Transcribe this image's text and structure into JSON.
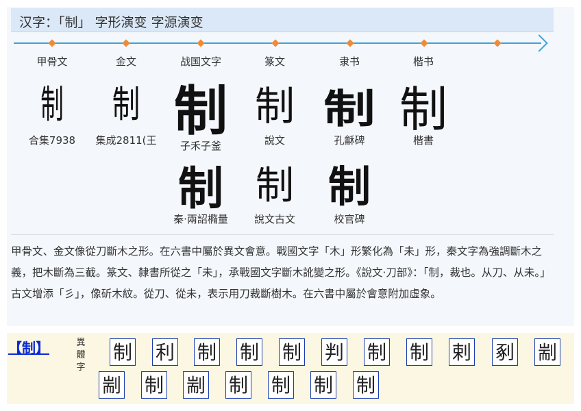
{
  "header": {
    "title": "汉字：「制」 字形演变 字源演变"
  },
  "timeline": {
    "columns": [
      {
        "label": "甲骨文"
      },
      {
        "label": "金文"
      },
      {
        "label": "战国文字"
      },
      {
        "label": "篆文"
      },
      {
        "label": "隶书"
      },
      {
        "label": "楷书"
      }
    ]
  },
  "forms_row1": [
    {
      "glyph": "制",
      "source": "合集7938"
    },
    {
      "glyph": "制",
      "source": "集成2811(王"
    },
    {
      "glyph": "制",
      "source": "子禾子釜"
    },
    {
      "glyph": "制",
      "source": "說文"
    },
    {
      "glyph": "制",
      "source": "孔龢碑"
    },
    {
      "glyph": "制",
      "source": "楷書"
    }
  ],
  "forms_row2": [
    {
      "glyph": "制",
      "source": "秦·兩詔橢量"
    },
    {
      "glyph": "制",
      "source": "說文古文"
    },
    {
      "glyph": "制",
      "source": "校官碑"
    }
  ],
  "description": "甲骨文、金文像從刀斷木之形。在六書中屬於異文會意。戰國文字「木」形繁化為「未」形，秦文字為強調斷木之義，把木斷為三截。篆文、隸書所從之「未」，承戰國文字斷木訛變之形。《說文·刀部》：「制，裁也。从刀、从未。」古文增添「彡」，像斫木紋。從刀、從未，表示用刀裁斷樹木。在六書中屬於會意附加虛象。",
  "variants": {
    "char_label": "【制】",
    "yiti_label": "異體字",
    "row1": [
      "制",
      "利",
      "制",
      "制",
      "制",
      "判",
      "制",
      "制",
      "剌",
      "剢",
      "剬"
    ],
    "row2": [
      "剬",
      "制",
      "剬",
      "制",
      "制",
      "制",
      "制"
    ]
  },
  "colors": {
    "accent": "#3aa3dd",
    "dot": "#f08a36",
    "link": "#0a2ad6",
    "box_border": "#1a3db0"
  }
}
